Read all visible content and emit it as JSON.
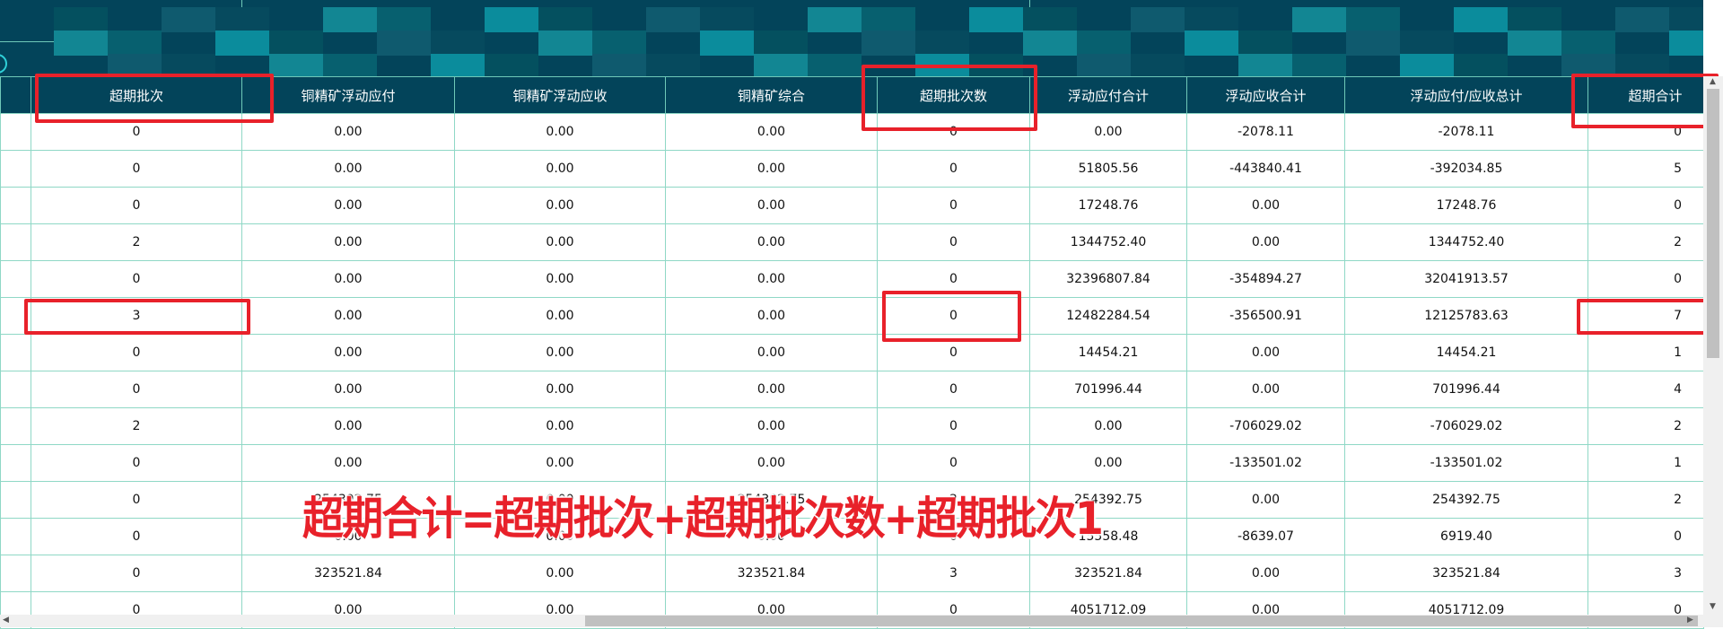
{
  "table": {
    "columns": [
      "",
      "超期批次",
      "铜精矿浮动应付",
      "铜精矿浮动应收",
      "铜精矿综合",
      "超期批次数",
      "浮动应付合计",
      "浮动应收合计",
      "浮动应付/应收总计",
      "超期合计"
    ],
    "rows": [
      [
        "",
        "0",
        "0.00",
        "0.00",
        "0.00",
        "0",
        "0.00",
        "-2078.11",
        "-2078.11",
        "0"
      ],
      [
        "",
        "0",
        "0.00",
        "0.00",
        "0.00",
        "0",
        "51805.56",
        "-443840.41",
        "-392034.85",
        "5"
      ],
      [
        "",
        "0",
        "0.00",
        "0.00",
        "0.00",
        "0",
        "17248.76",
        "0.00",
        "17248.76",
        "0"
      ],
      [
        "",
        "2",
        "0.00",
        "0.00",
        "0.00",
        "0",
        "1344752.40",
        "0.00",
        "1344752.40",
        "2"
      ],
      [
        "",
        "0",
        "0.00",
        "0.00",
        "0.00",
        "0",
        "32396807.84",
        "-354894.27",
        "32041913.57",
        "0"
      ],
      [
        "",
        "3",
        "0.00",
        "0.00",
        "0.00",
        "0",
        "12482284.54",
        "-356500.91",
        "12125783.63",
        "7"
      ],
      [
        "",
        "0",
        "0.00",
        "0.00",
        "0.00",
        "0",
        "14454.21",
        "0.00",
        "14454.21",
        "1"
      ],
      [
        "",
        "0",
        "0.00",
        "0.00",
        "0.00",
        "0",
        "701996.44",
        "0.00",
        "701996.44",
        "4"
      ],
      [
        "",
        "2",
        "0.00",
        "0.00",
        "0.00",
        "0",
        "0.00",
        "-706029.02",
        "-706029.02",
        "2"
      ],
      [
        "",
        "0",
        "0.00",
        "0.00",
        "0.00",
        "0",
        "0.00",
        "-133501.02",
        "-133501.02",
        "1"
      ],
      [
        "",
        "0",
        "254392.75",
        "0.00",
        "254392.75",
        "2",
        "254392.75",
        "0.00",
        "254392.75",
        "2"
      ],
      [
        "",
        "0",
        "0.00",
        "0.00",
        "0.00",
        "0",
        "15558.48",
        "-8639.07",
        "6919.40",
        "0"
      ],
      [
        "",
        "0",
        "323521.84",
        "0.00",
        "323521.84",
        "3",
        "323521.84",
        "0.00",
        "323521.84",
        "3"
      ],
      [
        "",
        "0",
        "0.00",
        "0.00",
        "0.00",
        "0",
        "4051712.09",
        "0.00",
        "4051712.09",
        "0"
      ]
    ]
  },
  "annotation": "超期合计=超期批次+超期批次数+超期批次1",
  "colors": {
    "header": "#03445a",
    "grid": "#8fd8c6",
    "highlight": "#e8212a"
  }
}
